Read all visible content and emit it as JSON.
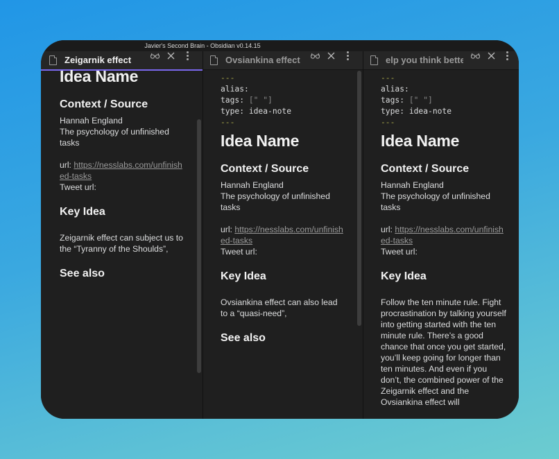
{
  "window_title": "Javier's Second Brain - Obsidian v0.14.15",
  "panes": [
    {
      "tab_title": "Zeigarnik effect",
      "heading": "Idea Name",
      "context_heading": "Context / Source",
      "author": "Hannah England",
      "description": "The psychology of unfinished tasks",
      "url_label": "url:",
      "url": "https://nesslabs.com/unfinished-tasks",
      "tweet_label": "Tweet url:",
      "key_idea_heading": "Key Idea",
      "key_idea_text": "Zeigarnik effect can subject us to the “Tyranny of the Shoulds”,",
      "see_also_heading": "See also"
    },
    {
      "tab_title": "Ovsiankina effect",
      "frontmatter": {
        "dashes": "---",
        "alias": "alias:",
        "tags_key": "tags:",
        "tags_val": "[\"  \"]",
        "type_key": "type:",
        "type_val": "idea-note"
      },
      "heading": "Idea Name",
      "context_heading": "Context / Source",
      "author": "Hannah England",
      "description": "The psychology of unfinished tasks",
      "url_label": "url:",
      "url": "https://nesslabs.com/unfinished-tasks",
      "tweet_label": "Tweet url:",
      "key_idea_heading": "Key Idea",
      "key_idea_text": "Ovsiankina effect can also lead to a “quasi-need”,",
      "see_also_heading": "See also"
    },
    {
      "tab_title": "elp you think bette",
      "frontmatter": {
        "dashes": "---",
        "alias": "alias:",
        "tags_key": "tags:",
        "tags_val": "[\"  \"]",
        "type_key": "type:",
        "type_val": "idea-note"
      },
      "heading": "Idea Name",
      "context_heading": "Context / Source",
      "author": "Hannah England",
      "description": "The psychology of unfinished tasks",
      "url_label": "url:",
      "url": "https://nesslabs.com/unfinished-tasks",
      "tweet_label": "Tweet url:",
      "key_idea_heading": "Key Idea",
      "key_idea_text": "Follow the ten minute rule. Fight procrastination by talking yourself into getting started with the ten minute rule. There’s a good chance that once you get started, you’ll keep going for longer than ten minutes. And even if you don’t, the combined power of the Zeigarnik effect and the Ovsiankina effect will"
    }
  ],
  "colors": {
    "active_tab_underline": "#7b68ee",
    "frontmatter_dash": "#a8a84a",
    "link": "#9a9a9a"
  }
}
